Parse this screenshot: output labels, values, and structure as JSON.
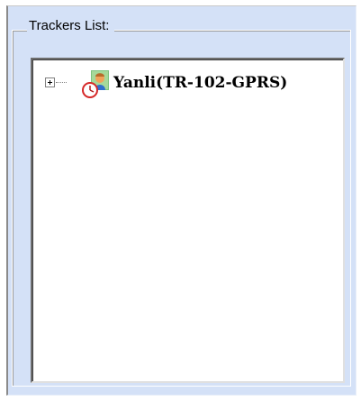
{
  "group": {
    "title": "Trackers List:"
  },
  "trackers": [
    {
      "label": "Yanli(TR-102-GPRS)",
      "icon": "tracker-person-icon",
      "expanded": false
    }
  ]
}
